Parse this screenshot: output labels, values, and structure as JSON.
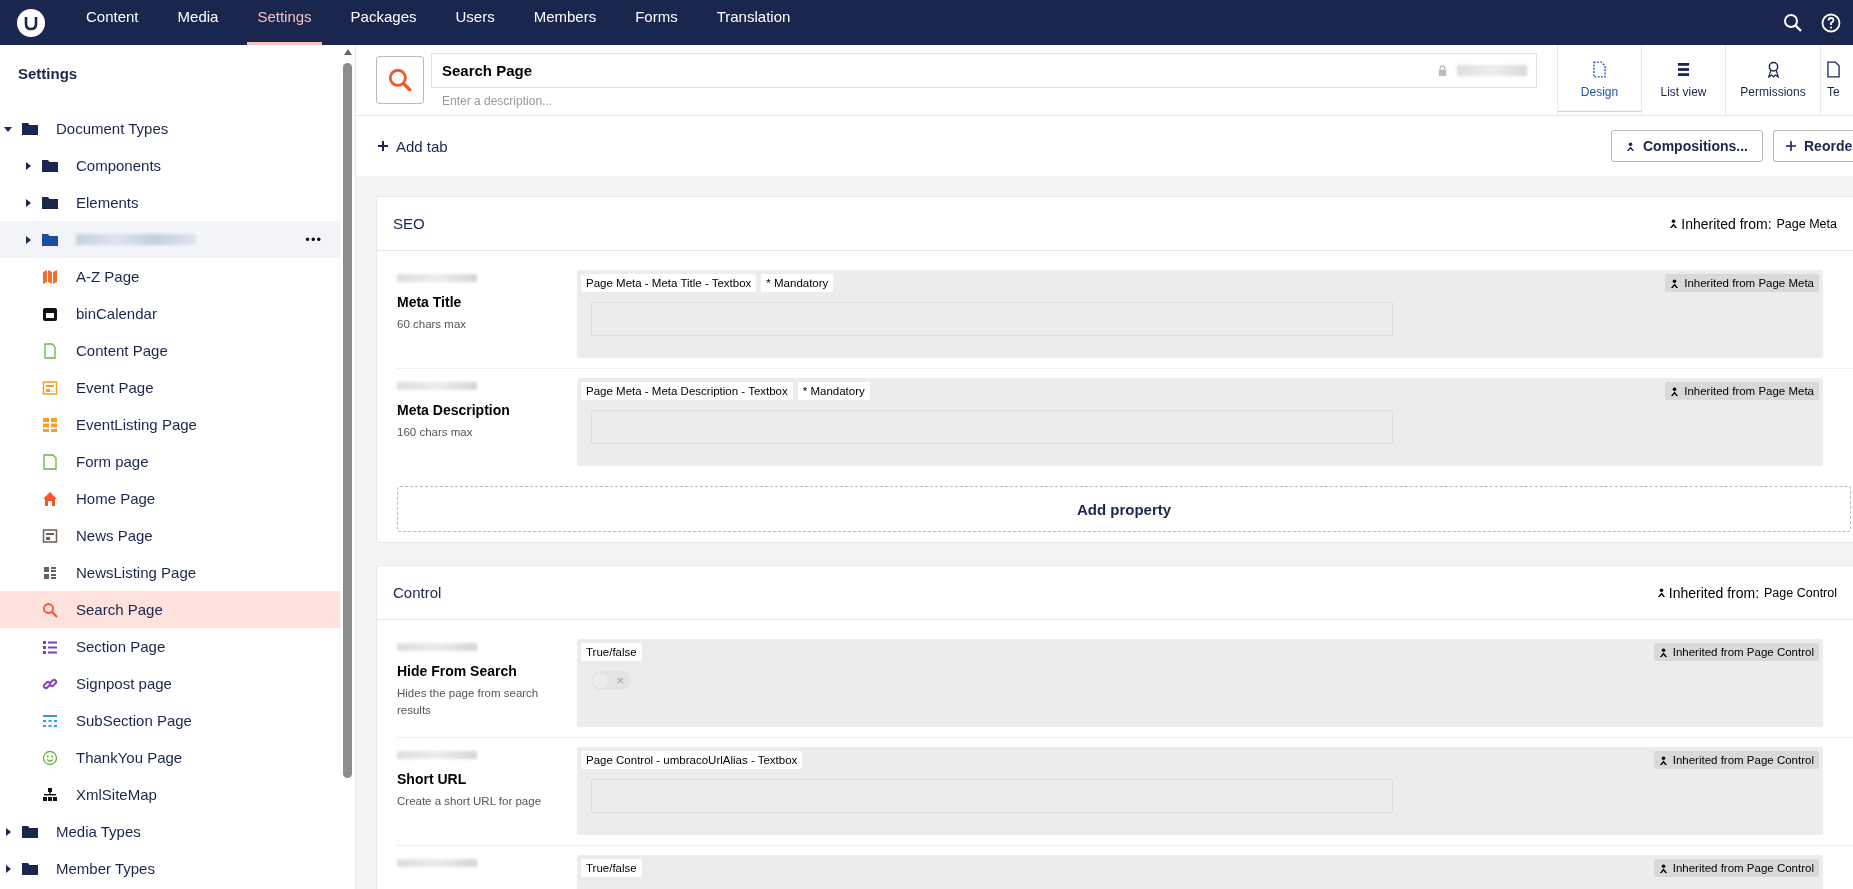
{
  "nav": [
    {
      "label": "Content",
      "selected": false
    },
    {
      "label": "Media",
      "selected": false
    },
    {
      "label": "Settings",
      "selected": true
    },
    {
      "label": "Packages",
      "selected": false
    },
    {
      "label": "Users",
      "selected": false
    },
    {
      "label": "Members",
      "selected": false
    },
    {
      "label": "Forms",
      "selected": false
    },
    {
      "label": "Translation",
      "selected": false
    }
  ],
  "sidebar": {
    "title": "Settings",
    "items": [
      {
        "label": "Document Types",
        "kind": "folder",
        "expanded": true,
        "selected": false,
        "children": [
          {
            "label": "Components",
            "kind": "folder",
            "expanded": false,
            "selected": false
          },
          {
            "label": "Elements",
            "kind": "folder",
            "expanded": false,
            "selected": false
          },
          {
            "kind": "folder",
            "expanded": false,
            "selected": false,
            "hovered": true,
            "menu": "•••"
          },
          {
            "label": "A-Z Page",
            "kind": "doctype",
            "selected": false
          },
          {
            "label": "binCalendar",
            "kind": "doctype",
            "selected": false
          },
          {
            "label": "Content Page",
            "kind": "doctype",
            "selected": false
          },
          {
            "label": "Event Page",
            "kind": "doctype",
            "selected": false
          },
          {
            "label": "EventListing Page",
            "kind": "doctype",
            "selected": false
          },
          {
            "label": "Form page",
            "kind": "doctype",
            "selected": false
          },
          {
            "label": "Home Page",
            "kind": "doctype",
            "selected": false
          },
          {
            "label": "News Page",
            "kind": "doctype",
            "selected": false
          },
          {
            "label": "NewsListing Page",
            "kind": "doctype",
            "selected": false
          },
          {
            "label": "Search Page",
            "kind": "doctype",
            "selected": true
          },
          {
            "label": "Section Page",
            "kind": "doctype",
            "selected": false
          },
          {
            "label": "Signpost page",
            "kind": "doctype",
            "selected": false
          },
          {
            "label": "SubSection Page",
            "kind": "doctype",
            "selected": false
          },
          {
            "label": "ThankYou Page",
            "kind": "doctype",
            "selected": false
          },
          {
            "label": "XmlSiteMap",
            "kind": "doctype",
            "selected": false
          }
        ]
      },
      {
        "label": "Media Types",
        "kind": "folder",
        "expanded": false,
        "selected": false
      },
      {
        "label": "Member Types",
        "kind": "folder",
        "expanded": false,
        "selected": false
      }
    ]
  },
  "header": {
    "name": "Search Page",
    "description_placeholder": "Enter a description...",
    "tabs": [
      {
        "label": "Design",
        "selected": true
      },
      {
        "label": "List view",
        "selected": false
      },
      {
        "label": "Permissions",
        "selected": false
      },
      {
        "label": "Te",
        "selected": false
      }
    ]
  },
  "toolbar": {
    "add_tab": "Add tab",
    "buttons": [
      "Compositions...",
      "Reorde"
    ]
  },
  "groups": [
    {
      "title": "SEO",
      "inherited_label": "Inherited from:",
      "inherited_source": "Page Meta",
      "add_property": "Add property",
      "properties": [
        {
          "name": "Meta Title",
          "description": "60 chars max",
          "kind": "textbox",
          "tags": [
            "Page Meta - Meta Title - Textbox",
            "* Mandatory"
          ],
          "inherited": "Inherited from Page Meta"
        },
        {
          "name": "Meta Description",
          "description": "160 chars max",
          "kind": "textbox",
          "tags": [
            "Page Meta - Meta Description - Textbox",
            "* Mandatory"
          ],
          "inherited": "Inherited from Page Meta"
        }
      ]
    },
    {
      "title": "Control",
      "inherited_label": "Inherited from:",
      "inherited_source": "Page Control",
      "properties": [
        {
          "name": "Hide From Search",
          "description": "Hides the page from search results",
          "kind": "toggle",
          "on": false,
          "tags": [
            "True/false"
          ],
          "inherited": "Inherited from Page Control"
        },
        {
          "name": "Short URL",
          "description": "Create a short URL for page",
          "kind": "textbox",
          "tags": [
            "Page Control - umbracoUrlAlias - Textbox"
          ],
          "inherited": "Inherited from Page Control"
        },
        {
          "tags": [
            "True/false"
          ],
          "inherited": "Inherited from Page Control"
        }
      ]
    }
  ]
}
